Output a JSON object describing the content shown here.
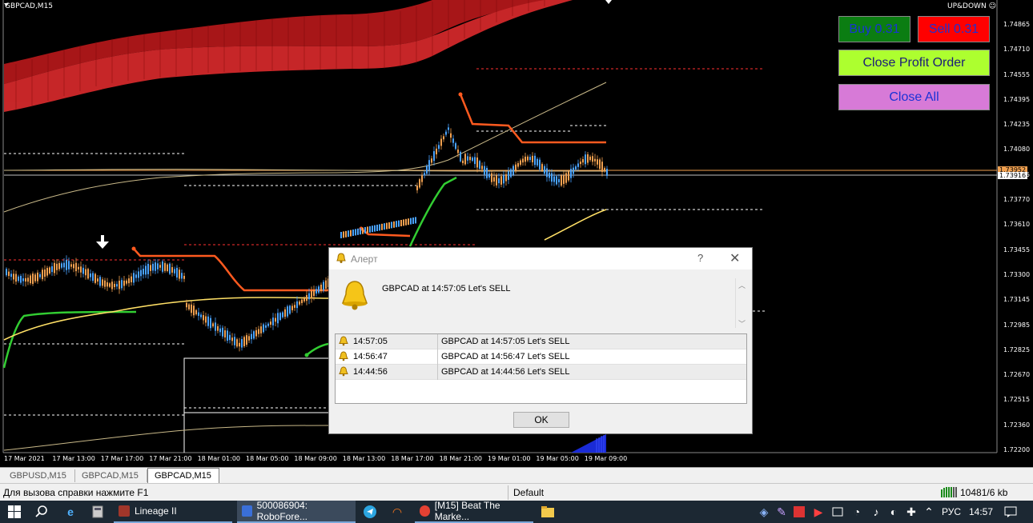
{
  "chart": {
    "symbol_title": "GBPCAD,M15",
    "indicator_name": "UP&DOWN",
    "price_labels": [
      "1.74865",
      "1.74710",
      "1.74555",
      "1.74395",
      "1.74235",
      "1.74080",
      "1.73925",
      "1.73770",
      "1.73610",
      "1.73455",
      "1.73300",
      "1.73145",
      "1.72985",
      "1.72825",
      "1.72670",
      "1.72515",
      "1.72360",
      "1.72200"
    ],
    "time_labels": [
      "17 Mar 2021",
      "17 Mar 13:00",
      "17 Mar 17:00",
      "17 Mar 21:00",
      "18 Mar 01:00",
      "18 Mar 05:00",
      "18 Mar 09:00",
      "18 Mar 13:00",
      "18 Mar 17:00",
      "18 Mar 21:00",
      "19 Mar 01:00",
      "19 Mar 05:00",
      "19 Mar 09:00"
    ],
    "bid_tag": "1.73952",
    "ask_tag": "1.73916",
    "colors": {
      "bid_tag": "#f0a050",
      "ask_tag": "#ffffff"
    }
  },
  "trade_panel": {
    "buy_label": "Buy 0.31",
    "sell_label": "Sell 0.31",
    "close_profit_label": "Close Profit Order",
    "close_all_label": "Close All"
  },
  "tabs": [
    {
      "label": "GBPUSD,M15",
      "active": false
    },
    {
      "label": "GBPCAD,M15",
      "active": false
    },
    {
      "label": "GBPCAD,M15",
      "active": true
    }
  ],
  "status_bar": {
    "help": "Для вызова справки нажмите F1",
    "profile": "Default",
    "traffic": "10481/6 kb"
  },
  "alert_dialog": {
    "title": "Алерт",
    "help_glyph": "?",
    "close_glyph": "✕",
    "message": "GBPCAD at 14:57:05 Let's  SELL",
    "rows": [
      {
        "time": "14:57:05",
        "message": "GBPCAD at 14:57:05 Let's  SELL"
      },
      {
        "time": "14:56:47",
        "message": "GBPCAD at 14:56:47 Let's  SELL"
      },
      {
        "time": "14:44:56",
        "message": "GBPCAD at 14:44:56 Let's  SELL"
      }
    ],
    "ok_label": "OK"
  },
  "taskbar": {
    "apps": [
      {
        "label": "Lineage II",
        "icon": "lineage-icon"
      },
      {
        "label": "500086904: RoboFore...",
        "icon": "metatrader-icon"
      },
      {
        "label": "[M15] Beat The Marke...",
        "icon": "chrome-icon"
      }
    ],
    "language": "РУС",
    "time": "14:57"
  }
}
